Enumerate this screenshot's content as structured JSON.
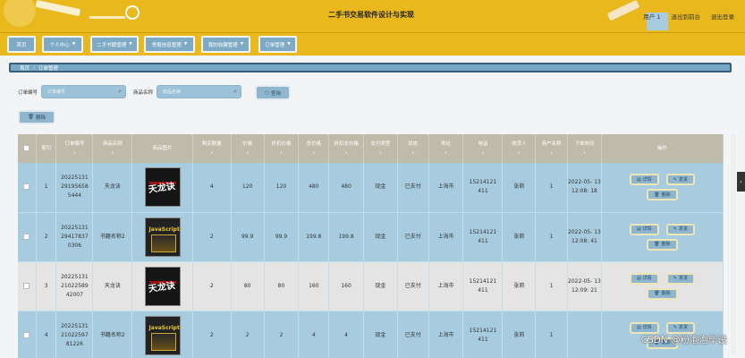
{
  "header": {
    "title": "二手书交易软件设计与实现",
    "user_link": "用户 1",
    "back_link": "退出到前台",
    "logout_link": "退出登录"
  },
  "nav": {
    "items": [
      {
        "label": "首页",
        "has_caret": false
      },
      {
        "label": "个人中心",
        "has_caret": true
      },
      {
        "label": "二手书籍管理",
        "has_caret": true
      },
      {
        "label": "举报信息管理",
        "has_caret": true
      },
      {
        "label": "我的收藏管理",
        "has_caret": true
      },
      {
        "label": "订单管理",
        "has_caret": true
      }
    ]
  },
  "breadcrumb": {
    "home": "首页",
    "separator": "/",
    "current": "订单管理"
  },
  "search": {
    "order_label": "订单编号",
    "order_placeholder": "订单编号",
    "name_label": "商品名称",
    "name_placeholder": "商品名称",
    "query_button": "查询"
  },
  "toolbar": {
    "delete_button": "删除"
  },
  "table": {
    "headers": [
      "索引",
      "订单编号",
      "商品名称",
      "商品图片",
      "购买数量",
      "价格",
      "折扣价格",
      "总价格",
      "折扣总价格",
      "支付类型",
      "状态",
      "地址",
      "电话",
      "收货人",
      "商户名称",
      "下单时间",
      "操作"
    ],
    "rows": [
      {
        "index": "1",
        "order_no": "20225131 29195658 5444",
        "name": "天龙诀",
        "qty": "4",
        "price": "120",
        "discount_price": "120",
        "total": "480",
        "discount_total": "480",
        "pay_type": "现金",
        "status": "已支付",
        "address": "上海市",
        "phone": "15214121 411",
        "receiver": "张莉",
        "merchant": "1",
        "time": "2022-05- 13 12:08: 18",
        "cover": "red"
      },
      {
        "index": "2",
        "order_no": "20225131 29417837 0306",
        "name": "书籍名称2",
        "qty": "2",
        "price": "99.9",
        "discount_price": "99.9",
        "total": "199.8",
        "discount_total": "199.8",
        "pay_type": "现金",
        "status": "已支付",
        "address": "上海市",
        "phone": "15214121 411",
        "receiver": "张莉",
        "merchant": "1",
        "time": "2022-05- 13 12:08: 41",
        "cover": "js"
      },
      {
        "index": "3",
        "order_no": "20225131 21022589 42007",
        "name": "天龙诀",
        "qty": "2",
        "price": "80",
        "discount_price": "80",
        "total": "160",
        "discount_total": "160",
        "pay_type": "现金",
        "status": "已支付",
        "address": "上海市",
        "phone": "15214121 411",
        "receiver": "张莉",
        "merchant": "1",
        "time": "2022-05- 13 12:09: 21",
        "cover": "red"
      },
      {
        "index": "4",
        "order_no": "20225131 21022597 81226",
        "name": "书籍名称2",
        "qty": "2",
        "price": "2",
        "discount_price": "2",
        "total": "4",
        "discount_total": "4",
        "pay_type": "现金",
        "status": "已支付",
        "address": "上海市",
        "phone": "15214121 411",
        "receiver": "张莉",
        "merchant": "1",
        "time": "",
        "cover": "js"
      }
    ],
    "actions": {
      "detail": "详情",
      "ship": "发货",
      "delete": "删除"
    }
  },
  "cover_text": {
    "red": "天龙诀",
    "js": "JavaScript"
  },
  "watermark": "CSDN @粉泡泡毕设"
}
